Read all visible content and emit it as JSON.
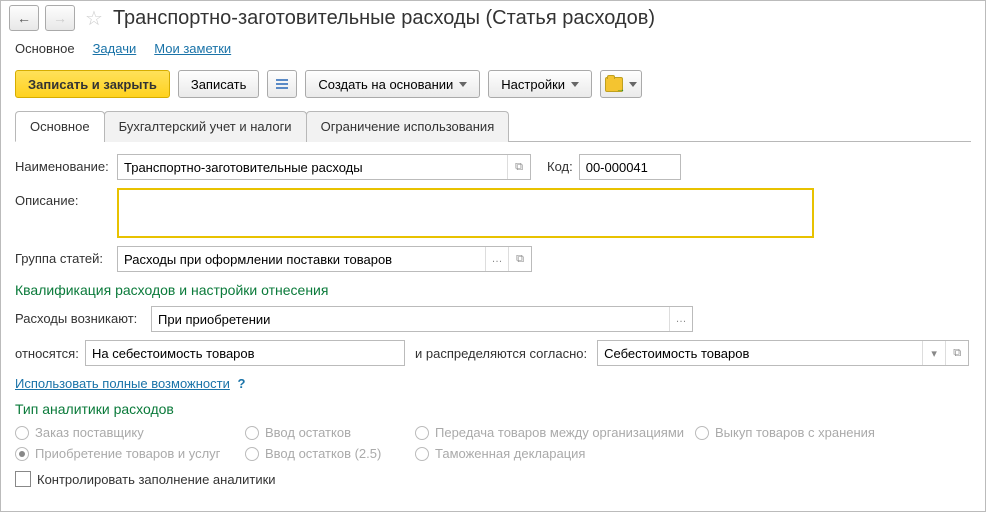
{
  "title": "Транспортно-заготовительные расходы (Статья расходов)",
  "navTabs": {
    "main": "Основное",
    "tasks": "Задачи",
    "notes": "Мои заметки"
  },
  "toolbar": {
    "saveClose": "Записать и закрыть",
    "save": "Записать",
    "createFrom": "Создать на основании",
    "settings": "Настройки"
  },
  "innerTabs": {
    "main": "Основное",
    "acct": "Бухгалтерский учет и налоги",
    "restrict": "Ограничение использования"
  },
  "labels": {
    "name": "Наименование:",
    "code": "Код:",
    "desc": "Описание:",
    "group": "Группа статей:",
    "q_section": "Квалификация расходов и настройки отнесения",
    "arise": "Расходы возникают:",
    "belong": "относятся:",
    "distrib_prefix": "и распределяются согласно:",
    "full_link": "Использовать полные возможности",
    "analytics_section": "Тип аналитики расходов",
    "control_cb": "Контролировать заполнение аналитики"
  },
  "values": {
    "name": "Транспортно-заготовительные расходы",
    "code": "00-000041",
    "desc": "",
    "group": "Расходы при оформлении поставки товаров",
    "arise": "При приобретении",
    "belong": "На себестоимость товаров",
    "distrib": "Себестоимость товаров"
  },
  "radios": {
    "r1": "Заказ поставщику",
    "r2": "Ввод остатков",
    "r3": "Передача товаров между организациями",
    "r4": "Выкуп товаров с хранения",
    "r5": "Приобретение товаров и услуг",
    "r6": "Ввод остатков (2.5)",
    "r7": "Таможенная декларация"
  }
}
